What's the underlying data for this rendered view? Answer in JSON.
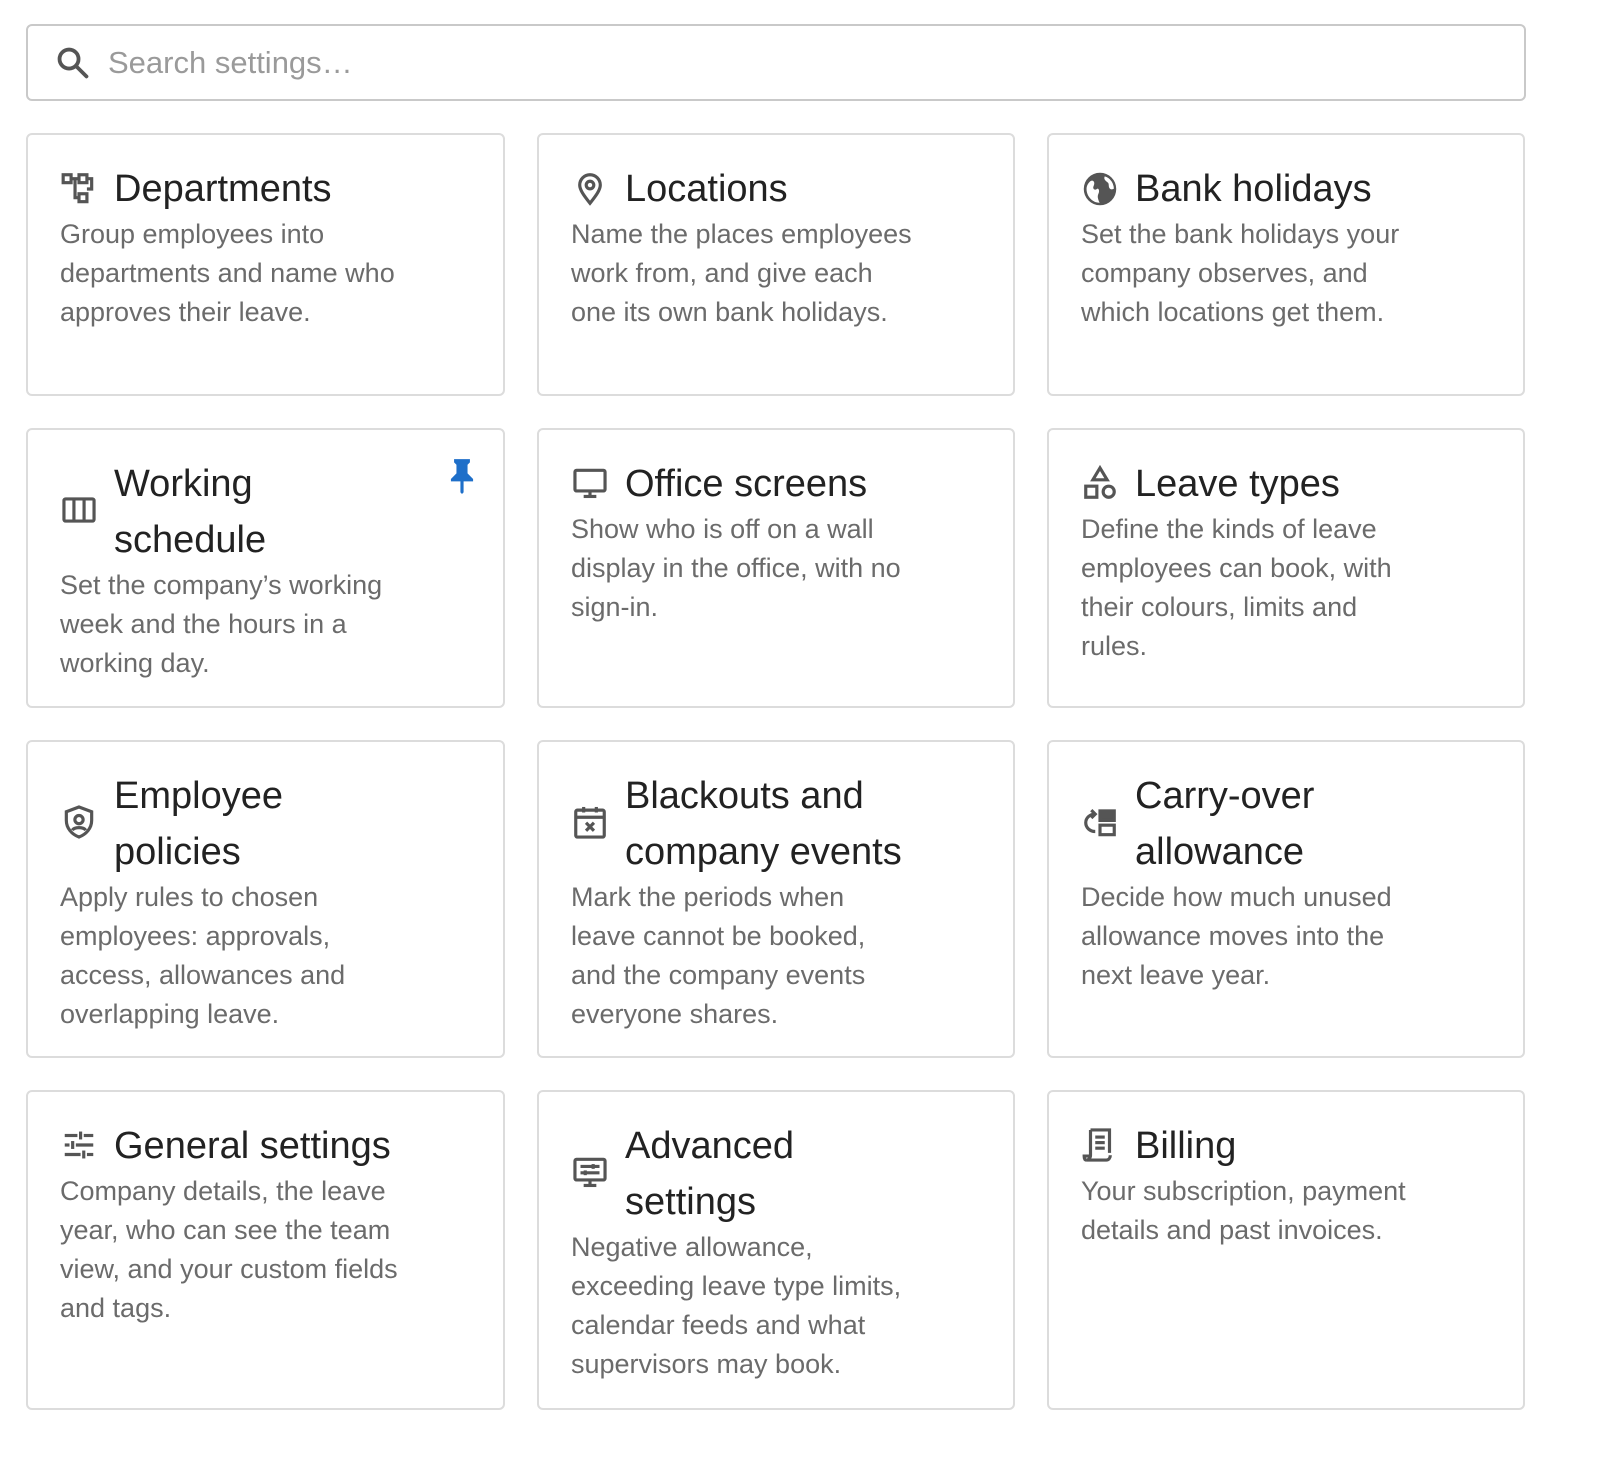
{
  "search": {
    "placeholder": "Search settings…",
    "icon": "search-icon"
  },
  "accent_color": "#1e6fc9",
  "cards": [
    {
      "title": "Departments",
      "description": "Group employees into departments and name who approves their leave.",
      "icon": "org-chart-icon",
      "pinned": false
    },
    {
      "title": "Locations",
      "description": "Name the places employees work from, and give each one its own bank holidays.",
      "icon": "location-pin-icon",
      "pinned": false
    },
    {
      "title": "Bank holidays",
      "description": "Set the bank holidays your company observes, and which locations get them.",
      "icon": "globe-icon",
      "pinned": false
    },
    {
      "title": "Working schedule",
      "description": "Set the company’s working week and the hours in a working day.",
      "icon": "columns-icon",
      "pinned": true
    },
    {
      "title": "Office screens",
      "description": "Show who is off on a wall display in the office, with no sign-in.",
      "icon": "monitor-icon",
      "pinned": false
    },
    {
      "title": "Leave types",
      "description": "Define the kinds of leave employees can book, with their colours, limits and rules.",
      "icon": "shapes-icon",
      "pinned": false
    },
    {
      "title": "Employee policies",
      "description": "Apply rules to chosen employees: approvals, access, allowances and overlapping leave.",
      "icon": "shield-person-icon",
      "pinned": false
    },
    {
      "title": "Blackouts and company events",
      "description": "Mark the periods when leave cannot be booked, and the company events everyone shares.",
      "icon": "calendar-blocked-icon",
      "pinned": false
    },
    {
      "title": "Carry-over allowance",
      "description": "Decide how much unused allowance moves into the next leave year.",
      "icon": "carry-over-icon",
      "pinned": false
    },
    {
      "title": "General settings",
      "description": "Company details, the leave year, who can see the team view, and your custom fields and tags.",
      "icon": "sliders-icon",
      "pinned": false
    },
    {
      "title": "Advanced settings",
      "description": "Negative allowance, exceeding leave type limits, calendar feeds and what supervisors may book.",
      "icon": "advanced-settings-icon",
      "pinned": false
    },
    {
      "title": "Billing",
      "description": "Your subscription, payment details and past invoices.",
      "icon": "receipt-icon",
      "pinned": false
    }
  ]
}
